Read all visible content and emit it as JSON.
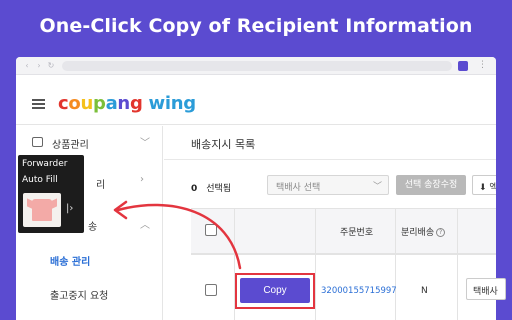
{
  "headline": "One-Click Copy of Recipient Information",
  "colors": {
    "accent": "#5b4bd0",
    "highlight": "#e3353f",
    "link": "#2b6fd6"
  },
  "logo": {
    "coupang": "coupang",
    "wing": "wing",
    "letter_colors": [
      "#e2352d",
      "#f58b1f",
      "#f5c11b",
      "#7bbf3a",
      "#2b9cd8",
      "#5b4bd0",
      "#e2352d"
    ]
  },
  "sidebar": {
    "items": [
      {
        "label": "상품관리",
        "icon": "box-icon"
      },
      {
        "label": "리",
        "icon": "list-icon"
      },
      {
        "label": "송",
        "icon": "truck-icon"
      }
    ],
    "sub_items": [
      {
        "label": "배송 관리",
        "active": true
      },
      {
        "label": "출고중지 요청",
        "active": false
      }
    ]
  },
  "main": {
    "title": "배송지시 목록",
    "selected_count": "0",
    "selected_label": "선택됨",
    "courier_select_placeholder": "택배사 선택",
    "invoice_button": "선택 송장수정",
    "excel_button": "엑",
    "table": {
      "headers": [
        "주문번호",
        "분리배송"
      ],
      "rows": [
        {
          "copy_label": "Copy",
          "order_number": "32000155715997",
          "split_shipping": "N",
          "courier": "택배사"
        }
      ]
    }
  },
  "overlay": {
    "line1": "Forwarder",
    "line2": "Auto Fill",
    "expand_icon": "chevron-right-icon"
  }
}
